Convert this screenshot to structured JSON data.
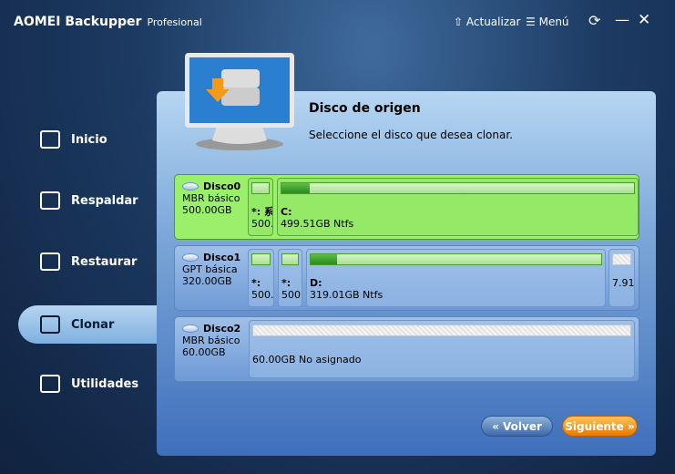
{
  "app": {
    "title": "AOMEI Backupper",
    "edition": "Profesional"
  },
  "toolbar": {
    "update": "Actualizar",
    "menu": "Menú"
  },
  "sidebar": {
    "items": [
      {
        "label": "Inicio"
      },
      {
        "label": "Respaldar"
      },
      {
        "label": "Restaurar"
      },
      {
        "label": "Clonar"
      },
      {
        "label": "Utilidades"
      }
    ]
  },
  "main": {
    "title": "Disco de origen",
    "subtitle": "Seleccione el disco que desea clonar."
  },
  "disks": [
    {
      "name": "Disco0",
      "type": "MBR básico",
      "size": "500.00GB",
      "parts": [
        {
          "label": "*: 系",
          "size": "500.",
          "used": 0
        },
        {
          "label": "C:",
          "size": "499.51GB Ntfs",
          "used": 0.08
        }
      ]
    },
    {
      "name": "Disco1",
      "type": "GPT básica",
      "size": "320.00GB",
      "parts": [
        {
          "label": "*:",
          "size": "500.",
          "used": 0
        },
        {
          "label": "*:",
          "size": "500.",
          "used": 0
        },
        {
          "label": "D:",
          "size": "319.01GB Ntfs",
          "used": 0.09
        },
        {
          "label": "",
          "size": "7.91",
          "used": 0
        }
      ]
    },
    {
      "name": "Disco2",
      "type": "MBR básico",
      "size": "60.00GB",
      "parts": [
        {
          "label": "",
          "size": "60.00GB No asignado",
          "used": 0
        }
      ]
    }
  ],
  "buttons": {
    "back": "« Volver",
    "next": "Siguiente »"
  },
  "colors": {
    "selected": "#9af06a",
    "accent": "#e67a00"
  }
}
